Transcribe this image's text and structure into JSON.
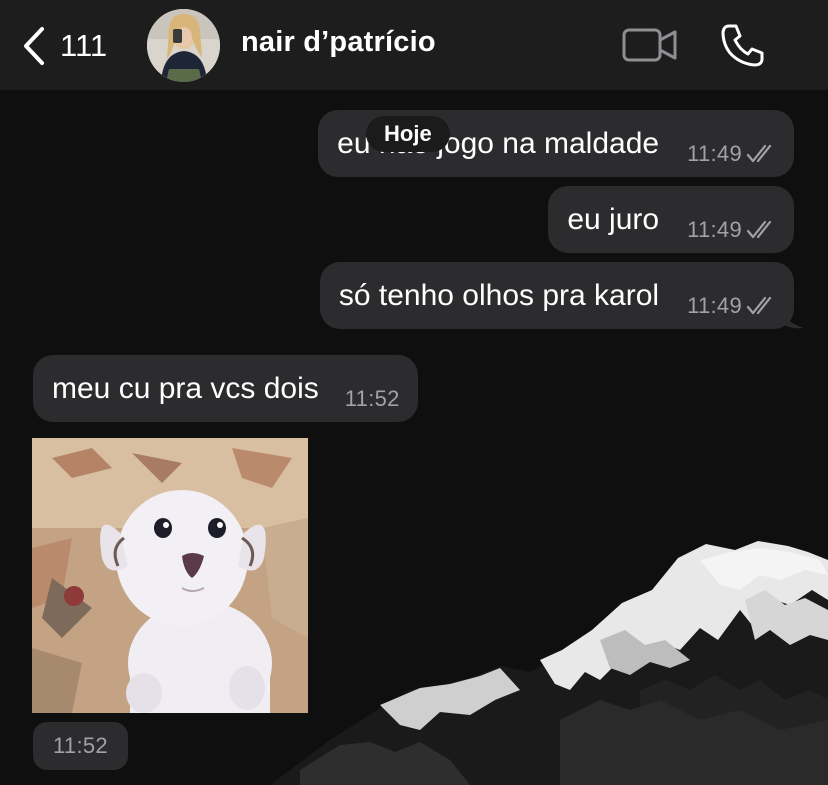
{
  "header": {
    "back_count": "111",
    "contact_name": "nair d’patrício"
  },
  "date_separator": "Hoje",
  "messages": [
    {
      "direction": "outgoing",
      "text": "eu não jogo na maldade",
      "time": "11:49",
      "status": "read"
    },
    {
      "direction": "outgoing",
      "text": "eu juro",
      "time": "11:49",
      "status": "read"
    },
    {
      "direction": "outgoing",
      "text": "só tenho olhos pra karol",
      "time": "11:49",
      "status": "read"
    },
    {
      "direction": "incoming",
      "text": "meu cu pra vcs dois",
      "time": "11:52"
    },
    {
      "direction": "incoming",
      "type": "sticker",
      "content": "white puppy",
      "time": "11:52"
    }
  ],
  "icons": {
    "back": "chevron-left-icon",
    "video": "video-camera-icon",
    "phone": "phone-icon",
    "read_receipt": "double-check-icon"
  },
  "colors": {
    "header_bg": "#1d1d1d",
    "bubble_bg": "#2c2c2e",
    "time_text": "#a2a2a6",
    "background": "#101010"
  }
}
